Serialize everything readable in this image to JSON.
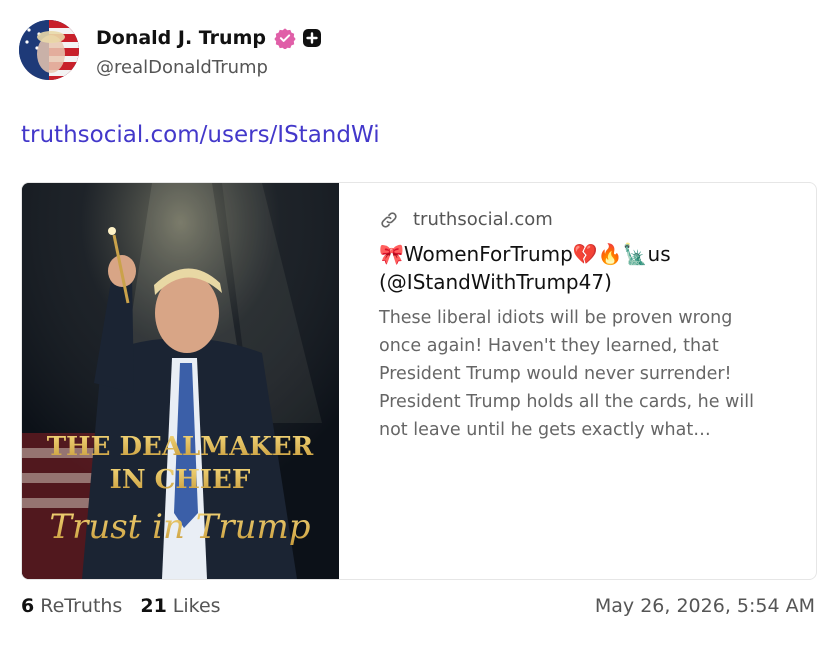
{
  "account": {
    "display_name": "Donald J. Trump",
    "handle": "@realDonaldTrump"
  },
  "post": {
    "link_text": "truthsocial.com/users/IStandWi"
  },
  "card": {
    "domain": "truthsocial.com",
    "title": "🎀WomenForTrump💔🔥🗽us (@IStandWithTrump47)",
    "description": "These liberal idiots will be proven wrong once again! Haven't they learned, that President Trump would never surrender! President Trump holds all the cards, he will not leave until he gets exactly what…",
    "image_text": {
      "line1": "THE DEALMAKER",
      "line2": "IN CHIEF",
      "line3": "Trust in Trump"
    }
  },
  "footer": {
    "retruths_count": "6",
    "retruths_label": "ReTruths",
    "likes_count": "21",
    "likes_label": "Likes",
    "timestamp": "May 26, 2026, 5:54 AM"
  },
  "colors": {
    "link": "#4338ca",
    "verified": "#e05fa8"
  }
}
